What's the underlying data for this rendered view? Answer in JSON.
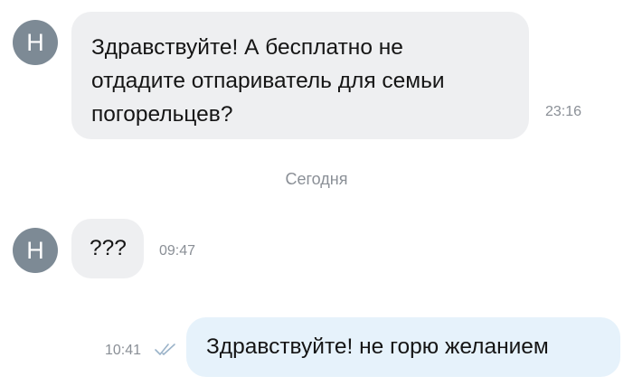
{
  "messages": [
    {
      "direction": "incoming",
      "avatar_letter": "Н",
      "text_lines": [
        "Здравствуйте! А бесплатно не",
        "отдадите отпариватель для семьи",
        "погорельцев?"
      ],
      "time": "23:16"
    },
    {
      "direction": "incoming",
      "avatar_letter": "Н",
      "text": "???",
      "time": "09:47"
    },
    {
      "direction": "outgoing",
      "text": "Здравствуйте! не горю желанием",
      "time": "10:41",
      "status_icon": "double-check-icon"
    }
  ],
  "date_separator": "Сегодня",
  "colors": {
    "avatar": "#7d8a95",
    "incoming_bubble": "#eeeff1",
    "outgoing_bubble": "#e6f2fb",
    "timestamp": "#8a8f96",
    "read_check": "#9bb3c9"
  }
}
